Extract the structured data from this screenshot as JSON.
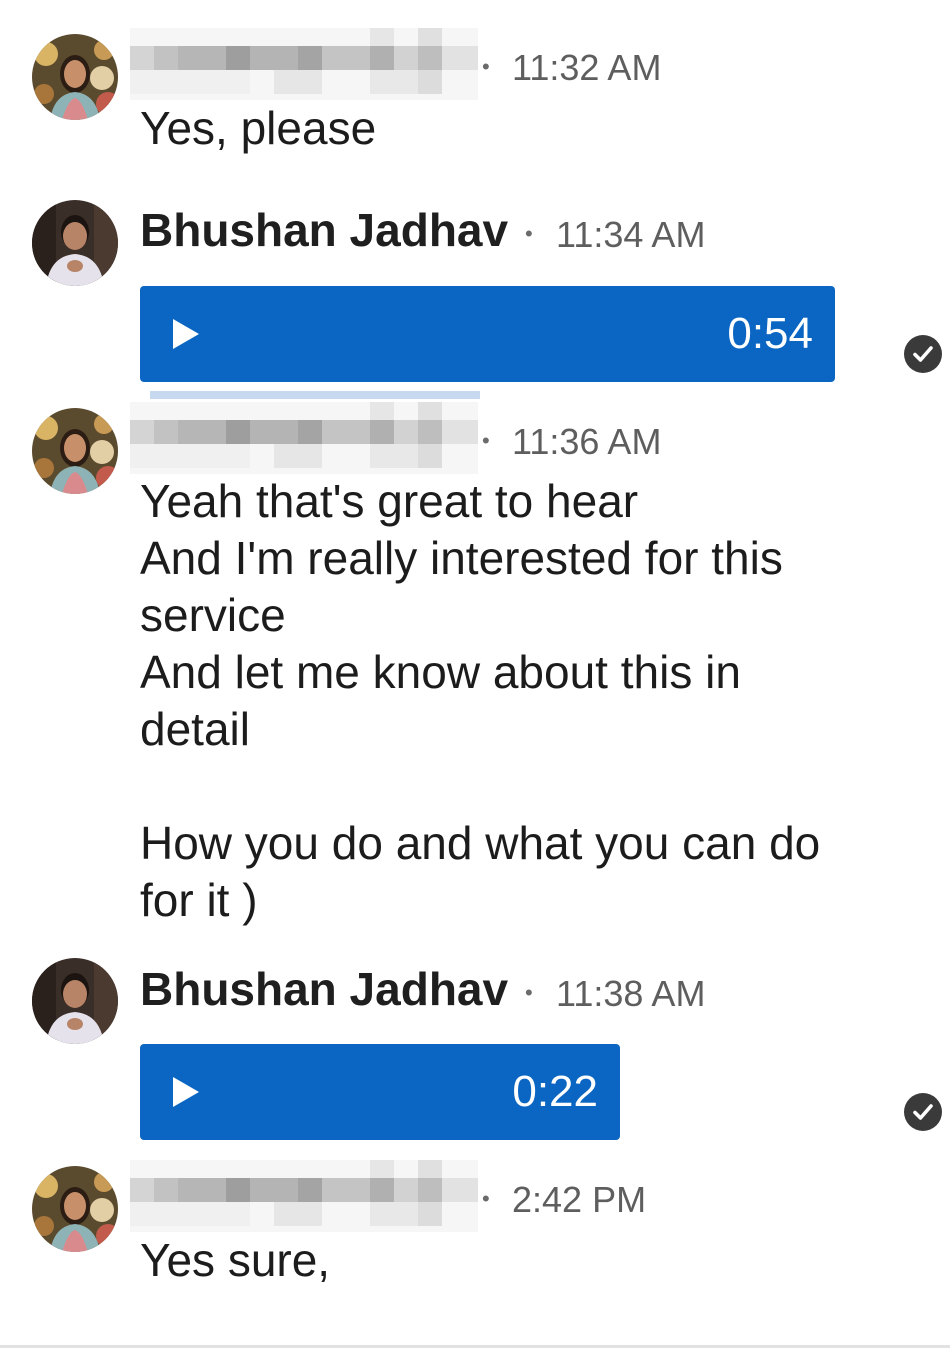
{
  "messages": [
    {
      "sender": "",
      "time": "11:32 AM",
      "text": "Yes, please",
      "avatar_icon": "woman-avatar"
    },
    {
      "sender": "Bhushan Jadhav",
      "time": "11:34 AM",
      "voice_duration": "0:54",
      "avatar_icon": "man-avatar",
      "status_icon": "sent-check-icon"
    },
    {
      "sender": "",
      "time": "11:36 AM",
      "text": "Yeah that's great to hear\nAnd I'm really interested for this\nservice\nAnd let me know about this in\ndetail\n\nHow you do and what you can do\nfor it )",
      "avatar_icon": "woman-avatar"
    },
    {
      "sender": "Bhushan Jadhav",
      "time": "11:38 AM",
      "voice_duration": "0:22",
      "avatar_icon": "man-avatar",
      "status_icon": "sent-check-icon"
    },
    {
      "sender": "",
      "time": "2:42 PM",
      "text": "Yes sure,",
      "avatar_icon": "woman-avatar"
    }
  ],
  "colors": {
    "voice_bubble": "#0a66c2",
    "timestamp": "#5e5e5e",
    "text": "#1c1c1c"
  }
}
